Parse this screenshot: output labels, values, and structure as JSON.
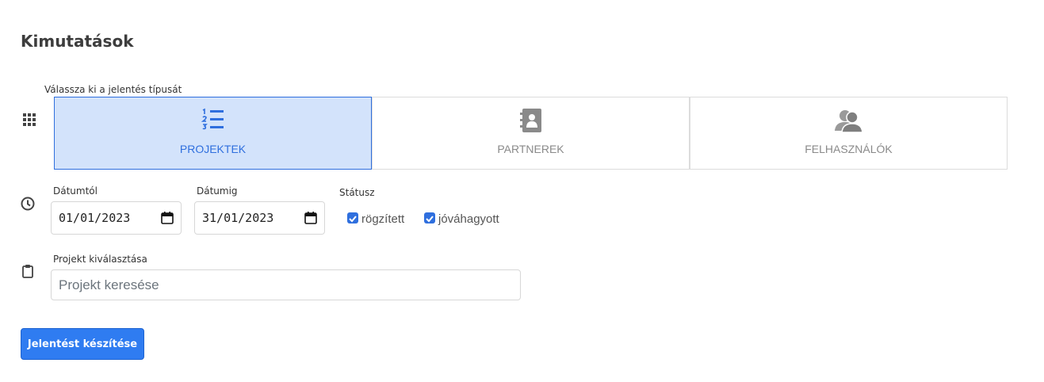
{
  "page": {
    "title": "Kimutatások"
  },
  "report_type": {
    "label": "Válassza ki a jelentés típusát",
    "row_icon": "grid-icon",
    "options": [
      {
        "label": "PROJEKTEK",
        "icon": "numbered-list-icon",
        "selected": true
      },
      {
        "label": "PARTNEREK",
        "icon": "contact-book-icon",
        "selected": false
      },
      {
        "label": "FELHASZNÁLÓK",
        "icon": "users-icon",
        "selected": false
      }
    ]
  },
  "filters": {
    "row_icon": "clock-icon",
    "date_from": {
      "label": "Dátumtól",
      "value": "01/01/2023"
    },
    "date_to": {
      "label": "Dátumig",
      "value": "31/01/2023"
    },
    "status": {
      "label": "Státusz",
      "options": [
        {
          "label": "rögzített",
          "checked": true
        },
        {
          "label": "jóváhagyott",
          "checked": true
        }
      ]
    }
  },
  "project": {
    "row_icon": "clipboard-icon",
    "label": "Projekt kiválasztása",
    "placeholder": "Projekt keresése"
  },
  "actions": {
    "submit_label": "Jelentést készítése"
  },
  "colors": {
    "accent": "#2f7cf1",
    "selected_bg": "#d3e3fb",
    "selected_border": "#2f6fde"
  }
}
